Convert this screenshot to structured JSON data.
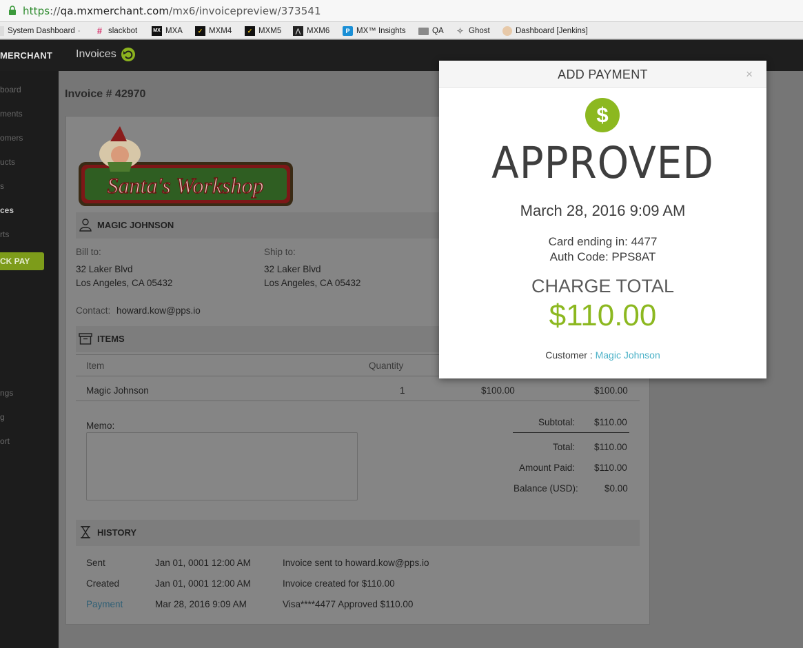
{
  "browser": {
    "url_scheme": "https",
    "url_separator": "://",
    "url_host": "qa.mxmerchant.com",
    "url_path": "/mx6/invoicepreview/373541",
    "bookmarks": [
      {
        "label": "System Dashboard",
        "icon": "page-icon"
      },
      {
        "label": "slackbot",
        "icon": "slack-icon"
      },
      {
        "label": "MXA",
        "icon": "mx-icon"
      },
      {
        "label": "MXM4",
        "icon": "check-icon"
      },
      {
        "label": "MXM5",
        "icon": "check-icon"
      },
      {
        "label": "MXM6",
        "icon": "mountain-icon"
      },
      {
        "label": "MX™ Insights",
        "icon": "p-icon"
      },
      {
        "label": "QA",
        "icon": "folder-icon"
      },
      {
        "label": "Ghost",
        "icon": "ghost-icon"
      },
      {
        "label": "Dashboard [Jenkins]",
        "icon": "jenkins-icon"
      }
    ]
  },
  "app": {
    "brand": "MERCHANT",
    "section": "Invoices",
    "accent_color": "#8cb820",
    "sidebar": [
      {
        "label": "board"
      },
      {
        "label": "ments"
      },
      {
        "label": "omers"
      },
      {
        "label": "ucts"
      },
      {
        "label": "s"
      },
      {
        "label": "ces",
        "active": true
      },
      {
        "label": "rts"
      },
      {
        "label": "ngs"
      },
      {
        "label": "g"
      },
      {
        "label": "ort"
      }
    ],
    "quick_pay": "CK PAY"
  },
  "invoice": {
    "title": "Invoice # 42970",
    "logo_text": "Santa's Workshop",
    "customer_name": "MAGIC JOHNSON",
    "bill_to_label": "Bill to:",
    "bill_to": [
      "32 Laker Blvd",
      "Los Angeles, CA 05432"
    ],
    "ship_to_label": "Ship to:",
    "ship_to": [
      "32 Laker Blvd",
      "Los Angeles, CA 05432"
    ],
    "contact_label": "Contact:",
    "contact_email": "howard.kow@pps.io",
    "items_heading": "ITEMS",
    "columns": {
      "item": "Item",
      "quantity": "Quantity"
    },
    "items": [
      {
        "name": "Magic Johnson",
        "quantity": "1",
        "price": "$100.00",
        "amount": "$100.00"
      }
    ],
    "memo_label": "Memo:",
    "totals": [
      {
        "label": "Subtotal:",
        "value": "$110.00"
      },
      {
        "label": "Total:",
        "value": "$110.00"
      },
      {
        "label": "Amount Paid:",
        "value": "$110.00"
      },
      {
        "label": "Balance (USD):",
        "value": "$0.00"
      }
    ],
    "history_heading": "HISTORY",
    "history": [
      {
        "event": "Sent",
        "date": "Jan 01, 0001 12:00 AM",
        "detail": "Invoice sent to howard.kow@pps.io"
      },
      {
        "event": "Created",
        "date": "Jan 01, 0001 12:00 AM",
        "detail": "Invoice created for $110.00"
      },
      {
        "event": "Payment",
        "date": "Mar 28, 2016 9:09 AM",
        "detail": "Visa****4477 Approved $110.00"
      }
    ]
  },
  "modal": {
    "title": "ADD PAYMENT",
    "close": "×",
    "dollar_symbol": "$",
    "status": "APPROVED",
    "datetime": "March 28, 2016 9:09 AM",
    "card_ending": "Card ending in: 4477",
    "auth_code": "Auth Code: PPS8AT",
    "charge_total_label": "CHARGE TOTAL",
    "charge_total": "$110.00",
    "customer_label": "Customer :",
    "customer_name": "Magic Johnson"
  }
}
